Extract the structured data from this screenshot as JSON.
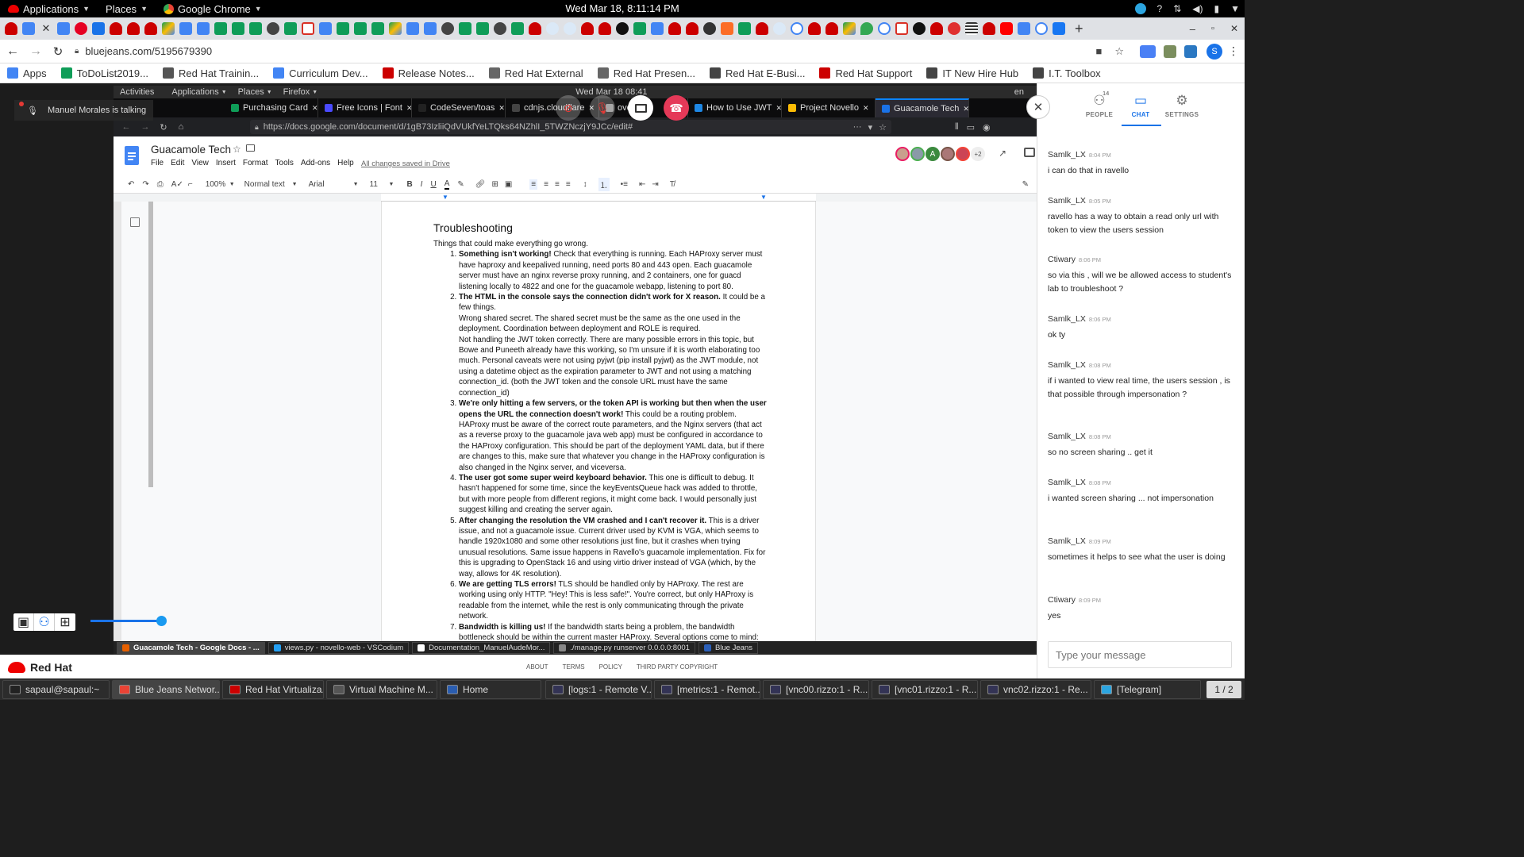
{
  "gnome": {
    "applications": "Applications",
    "places": "Places",
    "active_app": "Google Chrome",
    "clock": "Wed Mar 18,  8:11:14 PM"
  },
  "chrome": {
    "url": "bluejeans.com/5195679390",
    "bookmarks": [
      {
        "label": "Apps",
        "color": "#4285f4"
      },
      {
        "label": "ToDoList2019...",
        "color": "#0f9d58"
      },
      {
        "label": "Red Hat Trainin...",
        "color": "#555555"
      },
      {
        "label": "Curriculum Dev...",
        "color": "#4285f4"
      },
      {
        "label": "Release Notes...",
        "color": "#cc0000"
      },
      {
        "label": "Red Hat External",
        "color": "#666666"
      },
      {
        "label": "Red Hat Presen...",
        "color": "#666666"
      },
      {
        "label": "Red Hat E-Busi...",
        "color": "#444444"
      },
      {
        "label": "Red Hat Support",
        "color": "#cc0000"
      },
      {
        "label": "IT New Hire Hub",
        "color": "#444444"
      },
      {
        "label": "I.T. Toolbox",
        "color": "#444444"
      }
    ],
    "profile_initial": "S"
  },
  "shared_screen": {
    "talking": "Manuel Morales is talking",
    "inner_gnome": {
      "activities": "Activities",
      "applications": "Applications",
      "places": "Places",
      "firefox": "Firefox",
      "clock": "Wed Mar 18  08:41",
      "lang": "en"
    },
    "firefox_tabs": [
      "Purchasing Card",
      "Free Icons | Font",
      "CodeSeven/toas",
      "cdnjs.cloudflare",
      "ovelloUI",
      "How to Use JWT",
      "Project Novello",
      "Guacamole Tech"
    ],
    "firefox_url": "https://docs.google.com/document/d/1gB73IzliiQdVUkfYeLTQks64NZhlI_5TWZNczjY9JCc/edit#",
    "doc_title": "Guacamole Tech",
    "doc_menu": [
      "File",
      "Edit",
      "View",
      "Insert",
      "Format",
      "Tools",
      "Add-ons",
      "Help"
    ],
    "saved_status": "All changes saved in Drive",
    "collab_extra": "+2",
    "toolbar": {
      "zoom": "100%",
      "style": "Normal text",
      "font": "Arial",
      "size": "11"
    },
    "heading": "Troubleshooting",
    "intro": "Things that could make everything go wrong.",
    "items": [
      {
        "bold": "Something isn't working!",
        "text": " Check that everything is running. Each HAProxy server must have haproxy and keepalived running, need ports 80 and 443 open. Each guacamole server must have an nginx reverse proxy running, and 2 containers, one for guacd listening locally to 4822 and one for the guacamole webapp, listening to port 80.",
        "extra": []
      },
      {
        "bold": "The HTML in the console says the connection didn't work for X reason.",
        "text": " It could be a few things.",
        "extra": [
          "Wrong shared secret. The shared secret must be the same as the one used in the deployment. Coordination between deployment and ROLE is required.",
          "Not handling the JWT token correctly. There are many possible errors in this topic, but Bowe and Puneeth already have this working, so I'm unsure if it is worth elaborating too much. Personal caveats were not using pyjwt (pip install pyjwt) as the JWT module, not using a datetime object as the expiration parameter to JWT and not using a matching connection_id. (both the JWT token and the console URL must have the same connection_id)"
        ]
      },
      {
        "bold": "We're only hitting a few servers, or the token API is working but then when the user opens the URL the connection doesn't work!",
        "text": " This could be a routing problem. HAProxy must be aware of the correct route parameters, and the Nginx servers (that act as a reverse proxy to the guacamole java web app)  must be configured in accordance to the HAProxy configuration. This should be part of the deployment YAML data, but if there are changes to this, make sure that whatever you change in the HAProxy configuration is also changed in the Nginx server, and viceversa.",
        "extra": []
      },
      {
        "bold": "The user got some super weird keyboard behavior.",
        "text": " This one is difficult to debug. It hasn't happened for some time, since the keyEventsQueue hack was added to throttle, but with more people from different regions, it might come back. I would personally just suggest killing and creating the server again.",
        "extra": []
      },
      {
        "bold": "After changing the resolution the VM crashed and I can't recover it.",
        "text": " This is a driver issue, and not a guacamole issue. Current driver used by KVM is VGA, which seems to handle 1920x1080 and some other resolutions just fine, but it crashes when trying unusual resolutions. Same issue happens in Ravello's guacamole implementation. Fix for this is upgrading to OpenStack 16 and using virtio driver instead of VGA (which, by the way, allows for 4K resolution).",
        "extra": []
      },
      {
        "bold": "We are getting TLS errors!",
        "text": " TLS should be handled only by HAProxy. The rest are working using only HTTP. \"Hey! This is less safe!\". You're correct, but only HAProxy is readable from the internet, while the rest is only communicating through the private network.",
        "extra": []
      },
      {
        "bold": "Bandwidth is killing us!",
        "text": " If the bandwidth starts being a problem, the bandwidth bottleneck should be within the current master HAProxy. Several options come to mind:",
        "extra": []
      }
    ],
    "inner_taskbar": [
      "Guacamole Tech - Google Docs - ...",
      "views.py - novello-web - VSCodium",
      "Documentation_ManuelAudeMor...",
      "./manage.py runserver 0.0.0.0:8001",
      "Blue Jeans"
    ]
  },
  "bluejeans": {
    "brand": "Red Hat",
    "footer_links": [
      "ABOUT",
      "TERMS",
      "POLICY",
      "THIRD PARTY COPYRIGHT"
    ],
    "tabs": [
      {
        "label": "PEOPLE",
        "badge": "14"
      },
      {
        "label": "CHAT",
        "badge": ""
      },
      {
        "label": "SETTINGS",
        "badge": ""
      }
    ],
    "chat": [
      {
        "name": "Samlk_LX",
        "time": "8:04 PM",
        "text": "i can do that in ravello"
      },
      {
        "name": "Samlk_LX",
        "time": "8:05 PM",
        "text": "ravello has a way to obtain a read only url with token to view the users session"
      },
      {
        "name": "Ctiwary",
        "time": "8:06 PM",
        "text": "so via this , will we be allowed access to student's lab to troubleshoot ?"
      },
      {
        "name": "Samlk_LX",
        "time": "8:06 PM",
        "text": "ok ty"
      },
      {
        "name": "Samlk_LX",
        "time": "8:08 PM",
        "text": "if i wanted to view real time, the users session , is that possible through impersonation ?"
      },
      {
        "name": "Samlk_LX",
        "time": "8:08 PM",
        "text": "so no screen sharing .. get it"
      },
      {
        "name": "Samlk_LX",
        "time": "8:08 PM",
        "text": "i wanted screen sharing ... not impersonation"
      },
      {
        "name": "Samlk_LX",
        "time": "8:09 PM",
        "text": "sometimes it helps to see what the user is doing"
      },
      {
        "name": "Ctiwary",
        "time": "8:09 PM",
        "text": "yes"
      }
    ],
    "message_placeholder": "Type your message"
  },
  "taskbar": {
    "items": [
      "sapaul@sapaul:~",
      "Blue Jeans Networ...",
      "Red Hat Virtualiza...",
      "Virtual Machine M...",
      "Home",
      "[logs:1 - Remote V...",
      "[metrics:1 - Remot...",
      "[vnc00.rizzo:1 - R...",
      "[vnc01.rizzo:1 - R...",
      "vnc02.rizzo:1 - Re...",
      "[Telegram]"
    ],
    "workspace": "1 / 2"
  }
}
